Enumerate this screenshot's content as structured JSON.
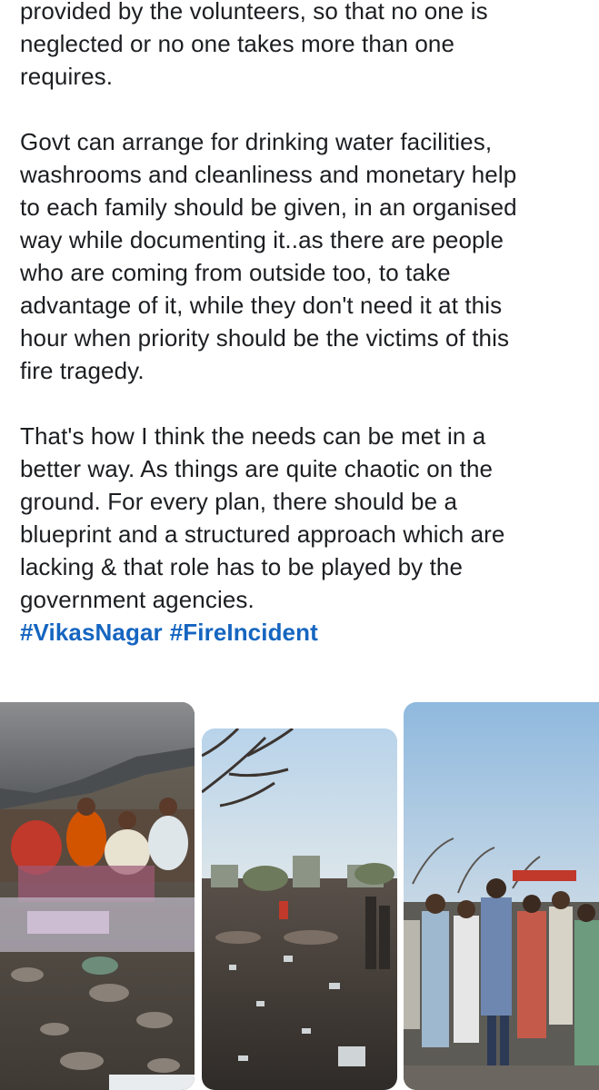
{
  "post": {
    "paragraphs": [
      "provided by the volunteers, so that no one is\nneglected or no one takes more than one\nrequires.",
      "Govt can arrange for drinking water facilities,\nwashrooms and cleanliness and monetary help\nto each family should be given, in an organised\nway while documenting it..as there are people\nwho are coming from outside too, to take\nadvantage of it, while they don't need it at this\nhour when priority should be the victims of this\nfire tragedy.",
      "That's how I think the needs can be met in a\nbetter way. As things are quite chaotic on the\nground. For every plan, there should be a\nblueprint and a structured approach which are\nlacking & that role has to be played by the\ngovernment agencies."
    ],
    "hashtags": [
      "#VikasNagar",
      "#FireIncident"
    ]
  },
  "photos": [
    {
      "subject": "families-under-tarp-image"
    },
    {
      "subject": "burnt-site-debris-image"
    },
    {
      "subject": "crowd-at-fire-site-image"
    }
  ],
  "colors": {
    "text": "#1c1e21",
    "hashtag": "#1565c0",
    "background": "#ffffff"
  }
}
